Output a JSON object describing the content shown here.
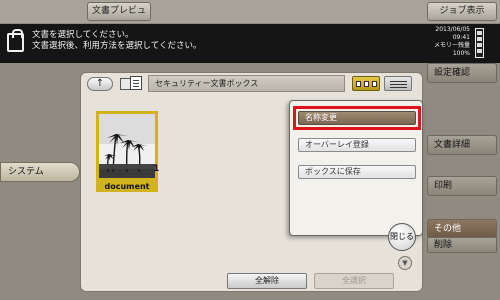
{
  "topbar": {
    "preview_label": "文書プレビュー",
    "job_label": "ジョブ表示"
  },
  "message": {
    "line1": "文書を選択してください。",
    "line2": "文書選択後、利用方法を選択してください。",
    "icon": "lock-icon"
  },
  "status": {
    "date": "2013/06/05",
    "time": "09:41",
    "memory_label": "メモリー残量",
    "memory_value": "100%"
  },
  "right_panel": {
    "confirm_label": "設定確認",
    "doc_detail_label": "文書詳細",
    "print_label": "印刷",
    "other_label": "その他",
    "delete_label": "削除"
  },
  "left_tab": {
    "system_label": "システム"
  },
  "box": {
    "up_icon": "up-arrow-icon",
    "box_icon": "box-documents-icon",
    "name": "セキュリティー文書ボックス",
    "thumb_view_icon": "thumbnail-view-icon",
    "list_view_icon": "list-view-icon"
  },
  "document": {
    "name": "document",
    "count": "1"
  },
  "bottom": {
    "release_all_label": "全解除",
    "select_all_label": "全選択"
  },
  "popup": {
    "rename_label": "名称変更",
    "overlay_label": "オーバーレイ登録",
    "save_to_box_label": "ボックスに保存",
    "close_label": "閉じる"
  },
  "colors": {
    "accent_selected": "#d1b21f",
    "highlight_red": "#e0131b",
    "active_brown": "#7a6652"
  }
}
